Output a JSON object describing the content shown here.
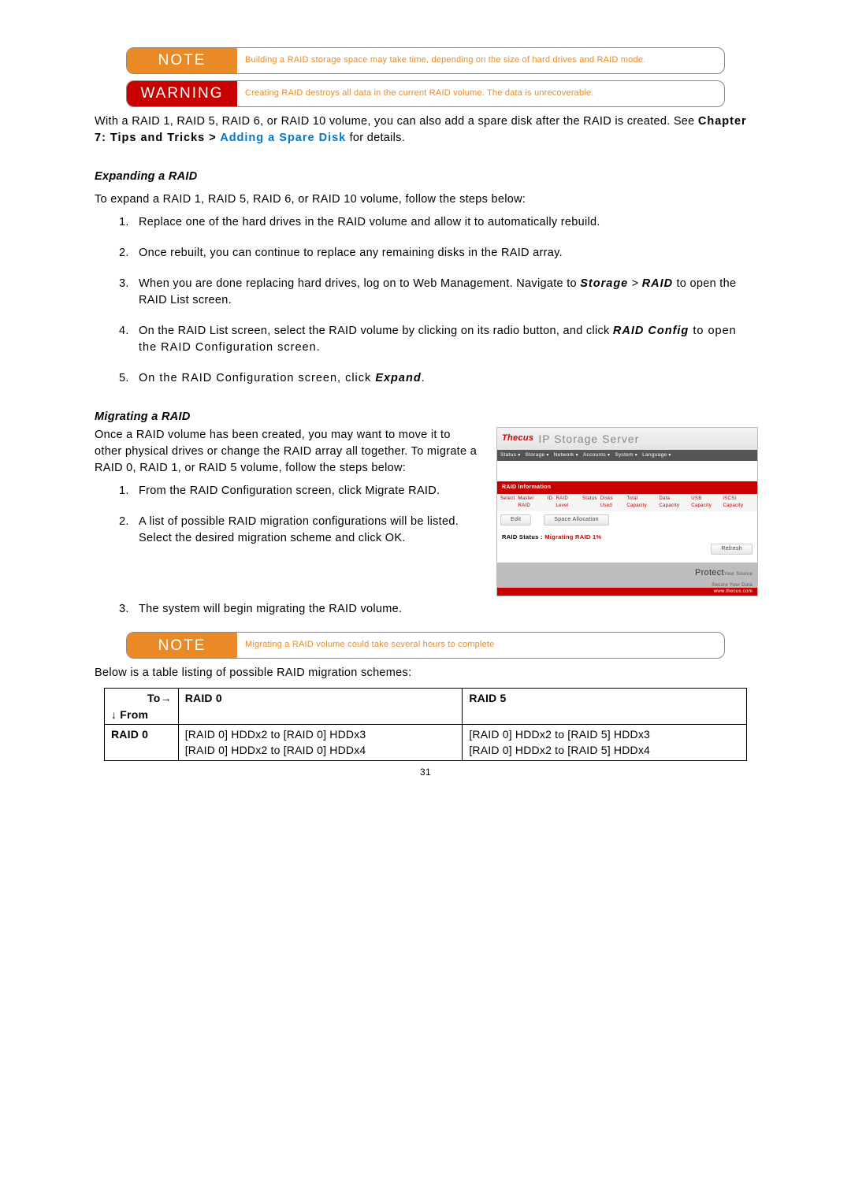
{
  "callout_note1": {
    "label": "NOTE",
    "text": "Building a RAID storage space may take time, depending on the size of hard drives and RAID mode."
  },
  "callout_warn": {
    "label": "WARNING",
    "text": "Creating RAID destroys all data in the current RAID volume. The data is unrecoverable."
  },
  "intro_para": {
    "pre": "With a RAID 1, RAID 5, RAID 6, or RAID 10 volume, you can also add a spare disk after the RAID is created. See ",
    "bold": "Chapter 7: Tips and Tricks > ",
    "link": "Adding a Spare Disk",
    "post": " for details."
  },
  "expand": {
    "heading": "Expanding a RAID",
    "lead": "To expand a RAID 1, RAID 5, RAID 6, or RAID 10 volume, follow the steps below:",
    "steps": {
      "s1": "Replace one of the hard drives in the RAID volume and allow it to automatically rebuild.",
      "s2": "Once rebuilt, you can continue to replace any remaining disks in the RAID array.",
      "s3a": "When you are done replacing hard drives, log on to Web Management. Navigate to ",
      "s3b": "Storage",
      "s3c": " > ",
      "s3d": "RAID",
      "s3e": " to open the RAID List screen.",
      "s4a": "On the RAID List screen, select the RAID volume by clicking on its radio button, and click ",
      "s4b": "RAID Config",
      "s4c": " to open the RAID Configuration screen.",
      "s5a": "On the RAID Configuration screen, click ",
      "s5b": "Expand",
      "s5c": "."
    }
  },
  "migrate": {
    "heading": "Migrating a RAID",
    "lead": "Once a RAID volume has been created, you may want to move it to other physical drives or change the RAID array all together. To migrate a RAID 0, RAID 1, or RAID 5 volume, follow the steps below:",
    "steps": {
      "s1": "From the RAID Configuration screen, click Migrate RAID.",
      "s2": "A list of possible RAID migration configurations will be listed. Select the desired migration scheme and click OK.",
      "s3": "The system will begin migrating the RAID volume."
    }
  },
  "callout_note2": {
    "label": "NOTE",
    "text": "Migrating a RAID volume could take several hours to complete"
  },
  "table_intro": "Below is a table listing of possible RAID migration schemes:",
  "table": {
    "to_label": "To→",
    "from_label": "↓ From",
    "col1": "RAID 0",
    "col2": "RAID 5",
    "row1_label": "RAID 0",
    "r1c1a": "[RAID 0] HDDx2 to [RAID 0] HDDx3",
    "r1c1b": "[RAID 0] HDDx2 to [RAID 0] HDDx4",
    "r1c2a": "[RAID 0] HDDx2 to [RAID 5] HDDx3",
    "r1c2b": "[RAID 0] HDDx2 to [RAID 5] HDDx4"
  },
  "screenshot": {
    "logo": "Thecus",
    "title": "IP Storage Server",
    "nav": [
      "Status",
      "Storage",
      "Network",
      "Accounts",
      "System",
      "Language"
    ],
    "panel_title": "RAID Information",
    "cols": [
      "Select",
      "Master RAID",
      "ID",
      "RAID Level",
      "Status",
      "Disks Used",
      "Total Capacity",
      "Data Capacity",
      "USB Capacity",
      "iSCSI Capacity"
    ],
    "btn_edit": "Edit",
    "btn_capacity": "Space Allocation",
    "status_label": "RAID Status :",
    "status_value": "Migrating RAID 1%",
    "refresh": "Refresh",
    "protect1": "Protect",
    "protect2": "Your Source",
    "protect3": "Secure Your Data",
    "footer_url": "www.thecus.com"
  },
  "page_number": "31"
}
